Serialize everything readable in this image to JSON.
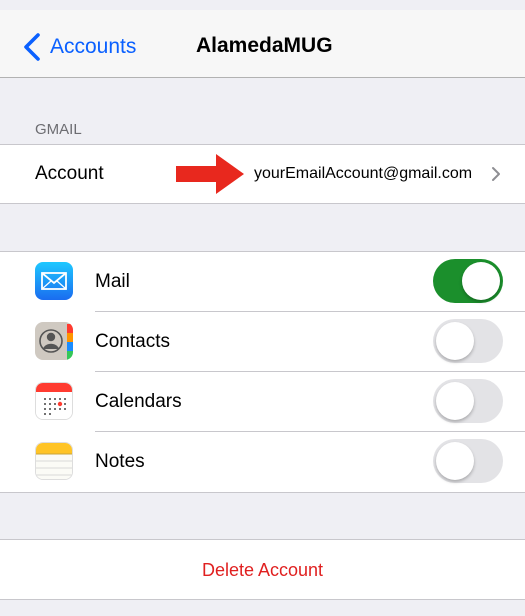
{
  "nav": {
    "back_label": "Accounts",
    "title": "AlamedaMUG"
  },
  "section": {
    "header": "GMAIL"
  },
  "account": {
    "label": "Account",
    "value": "yourEmailAccount@gmail.com"
  },
  "services": [
    {
      "label": "Mail",
      "enabled": true,
      "icon": "mail-icon"
    },
    {
      "label": "Contacts",
      "enabled": false,
      "icon": "contacts-icon"
    },
    {
      "label": "Calendars",
      "enabled": false,
      "icon": "calendar-icon"
    },
    {
      "label": "Notes",
      "enabled": false,
      "icon": "notes-icon"
    }
  ],
  "actions": {
    "delete_label": "Delete Account"
  },
  "colors": {
    "accent": "#0a60ff",
    "toggle_on": "#1b8f2c",
    "destructive": "#e02020",
    "annotation_arrow": "#e8281e"
  }
}
